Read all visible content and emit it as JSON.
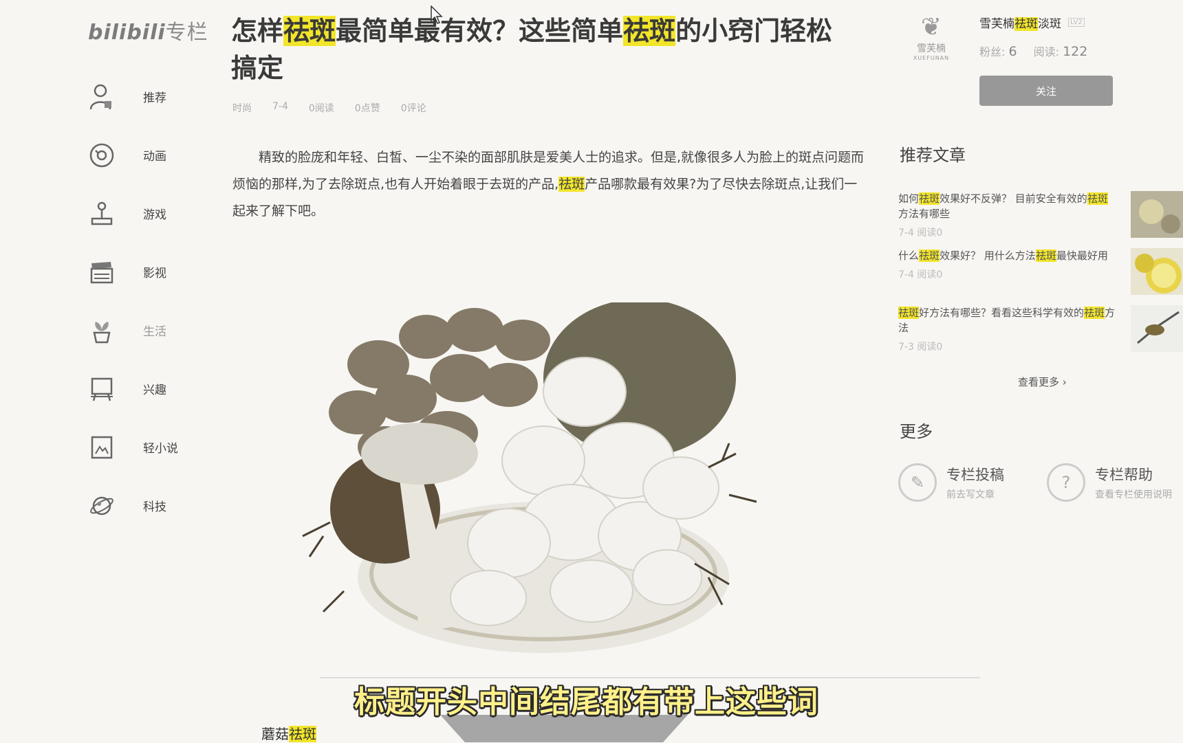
{
  "logo": {
    "brand": "bilibili",
    "suffix": "专栏"
  },
  "nav": [
    {
      "label": "推荐",
      "icon": "user-icon"
    },
    {
      "label": "动画",
      "icon": "disc-icon"
    },
    {
      "label": "游戏",
      "icon": "joystick-icon"
    },
    {
      "label": "影视",
      "icon": "clapperboard-icon"
    },
    {
      "label": "生活",
      "icon": "plant-icon"
    },
    {
      "label": "兴趣",
      "icon": "easel-icon"
    },
    {
      "label": "轻小说",
      "icon": "book-icon"
    },
    {
      "label": "科技",
      "icon": "planet-icon"
    }
  ],
  "article": {
    "title_parts": [
      "怎样",
      "祛斑",
      "最简单最有效？这些简单",
      "祛斑",
      "的小窍门轻松搞定"
    ],
    "meta": {
      "category": "时尚",
      "date": "7-4",
      "reads": "0阅读",
      "likes": "0点赞",
      "comments": "0评论"
    },
    "body_parts": [
      "精致的脸庞和年轻、白皙、一尘不染的面部肌肤是爱美人士的追求。但是,就像很多人为脸上的斑点问题而烦恼的那样,为了去除斑点,也有人开始着眼于去斑的产品,",
      "祛斑",
      "产品哪款最有效果?为了尽快去除斑点,让我们一起来了解下吧。"
    ],
    "caption_parts": [
      "蘑菇",
      "祛斑"
    ]
  },
  "subtitle": "标题开头中间结尾都有带上这些词",
  "author": {
    "logo_text": "雪芙楠",
    "logo_en": "XUEFUNAN",
    "name_parts": [
      "雪芙楠",
      "祛斑",
      "淡斑"
    ],
    "level": "LV2",
    "fans_label": "粉丝:",
    "fans": "6",
    "reads_label": "阅读:",
    "reads": "122",
    "follow_label": "关注"
  },
  "recommend": {
    "title": "推荐文章",
    "items": [
      {
        "title_parts": [
          "如何",
          "祛斑",
          "效果好不反弹？ 目前安全有效的",
          "祛斑",
          "方法有哪些"
        ],
        "meta": "7-4 阅读0"
      },
      {
        "title_parts": [
          "什么",
          "祛斑",
          "效果好？ 用什么方法",
          "祛斑",
          "最快最好用"
        ],
        "meta": "7-4 阅读0"
      },
      {
        "title_parts": [
          "",
          "祛斑",
          "好方法有哪些？看看这些科学有效的",
          "祛斑",
          "方法"
        ],
        "meta": "7-3 阅读0"
      }
    ],
    "see_more": "查看更多"
  },
  "more": {
    "title": "更多",
    "items": [
      {
        "title": "专栏投稿",
        "sub": "前去写文章",
        "icon": "pen-icon"
      },
      {
        "title": "专栏帮助",
        "sub": "查看专栏使用说明",
        "icon": "question-icon"
      }
    ]
  },
  "colors": {
    "highlight": "#f2e52a",
    "background": "#f7f6f3",
    "follow_button": "#989898"
  }
}
